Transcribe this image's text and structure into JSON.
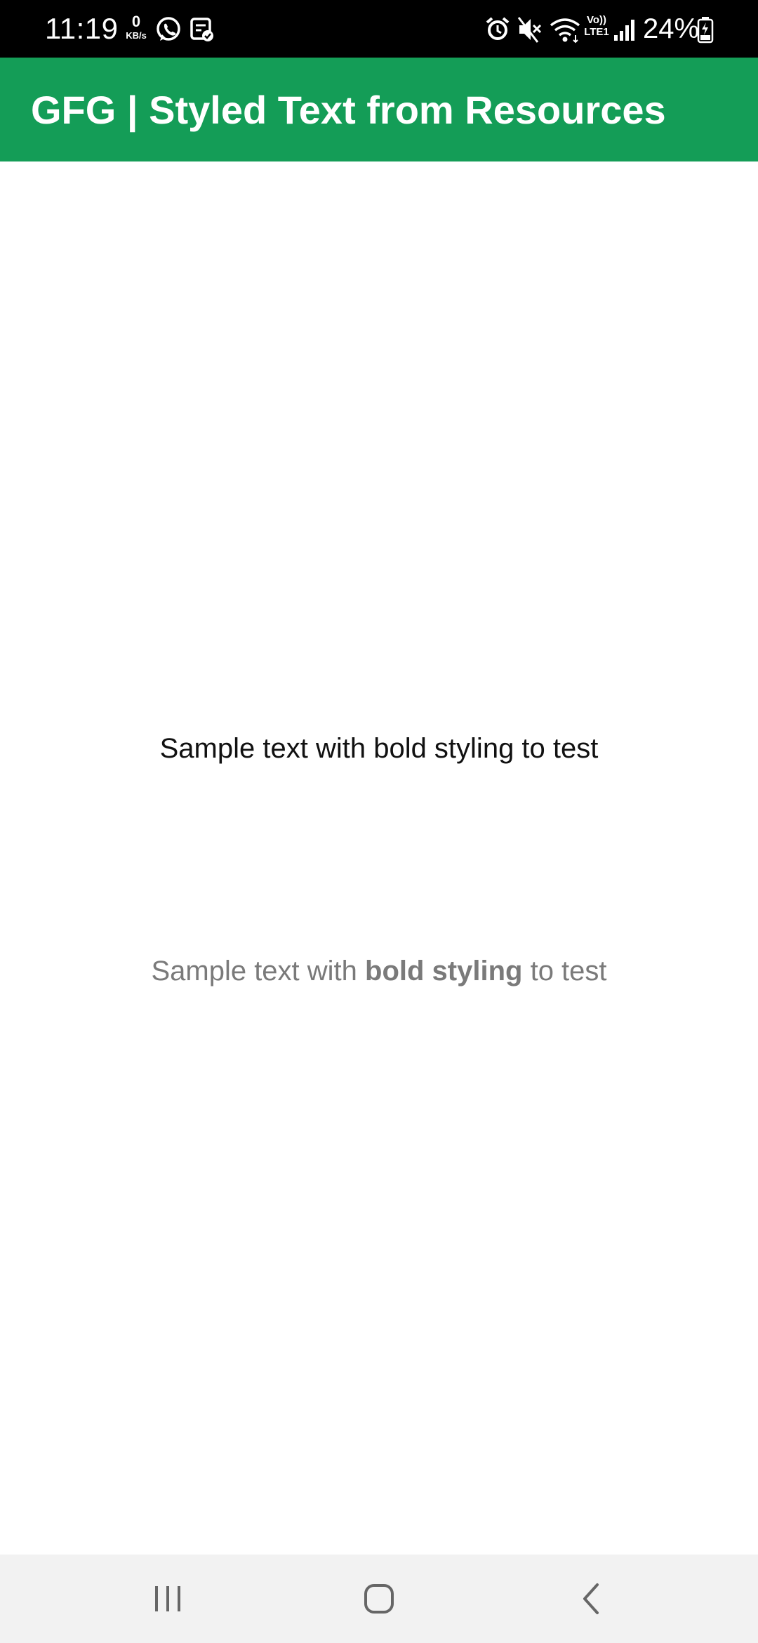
{
  "status_bar": {
    "time": "11:19",
    "net_speed_value": "0",
    "net_speed_unit": "KB/s",
    "battery_percent": "24%",
    "icons": [
      "whatsapp-icon",
      "notes-check-icon",
      "alarm-icon",
      "mute-icon",
      "wifi-icon",
      "volte-lte-icon",
      "signal-icon",
      "battery-charging-icon"
    ],
    "volte_label": "Vo))",
    "lte_label": "LTE1"
  },
  "app_bar": {
    "title": "GFG | Styled Text from Resources",
    "color": "#149d57"
  },
  "main": {
    "plain_text": "Sample text with bold styling to test",
    "styled_text": {
      "prefix": "Sample text with ",
      "bold": "bold styling",
      "suffix": " to test"
    }
  },
  "nav_bar": {
    "buttons": [
      "recent-apps-icon",
      "home-icon",
      "back-icon"
    ]
  }
}
